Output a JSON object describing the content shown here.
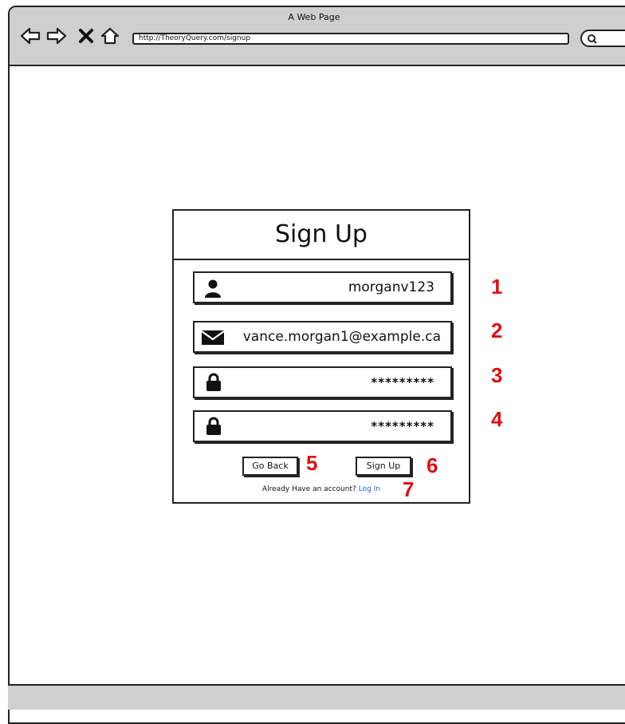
{
  "browser": {
    "window_title": "A Web Page",
    "url": "http://TheoryQuery.com/signup",
    "nav_icons": [
      "back-arrow-icon",
      "forward-arrow-icon",
      "close-icon",
      "home-icon"
    ],
    "search_icon": "search-icon"
  },
  "signup": {
    "title": "Sign Up",
    "fields": [
      {
        "icon": "user-icon",
        "value": "morganv123"
      },
      {
        "icon": "envelope-icon",
        "value": "vance.morgan1@example.ca"
      },
      {
        "icon": "lock-icon",
        "value": "*********"
      },
      {
        "icon": "lock-icon",
        "value": "*********"
      }
    ],
    "go_back_label": "Go Back",
    "sign_up_label": "Sign Up",
    "account_prompt": "Already Have an account?",
    "login_link": "Log In"
  },
  "annotations": [
    "1",
    "2",
    "3",
    "4",
    "5",
    "6",
    "7"
  ],
  "colors": {
    "chrome": "#cfcfcf",
    "annotation": "#e01010",
    "link": "#1a5fd6"
  }
}
